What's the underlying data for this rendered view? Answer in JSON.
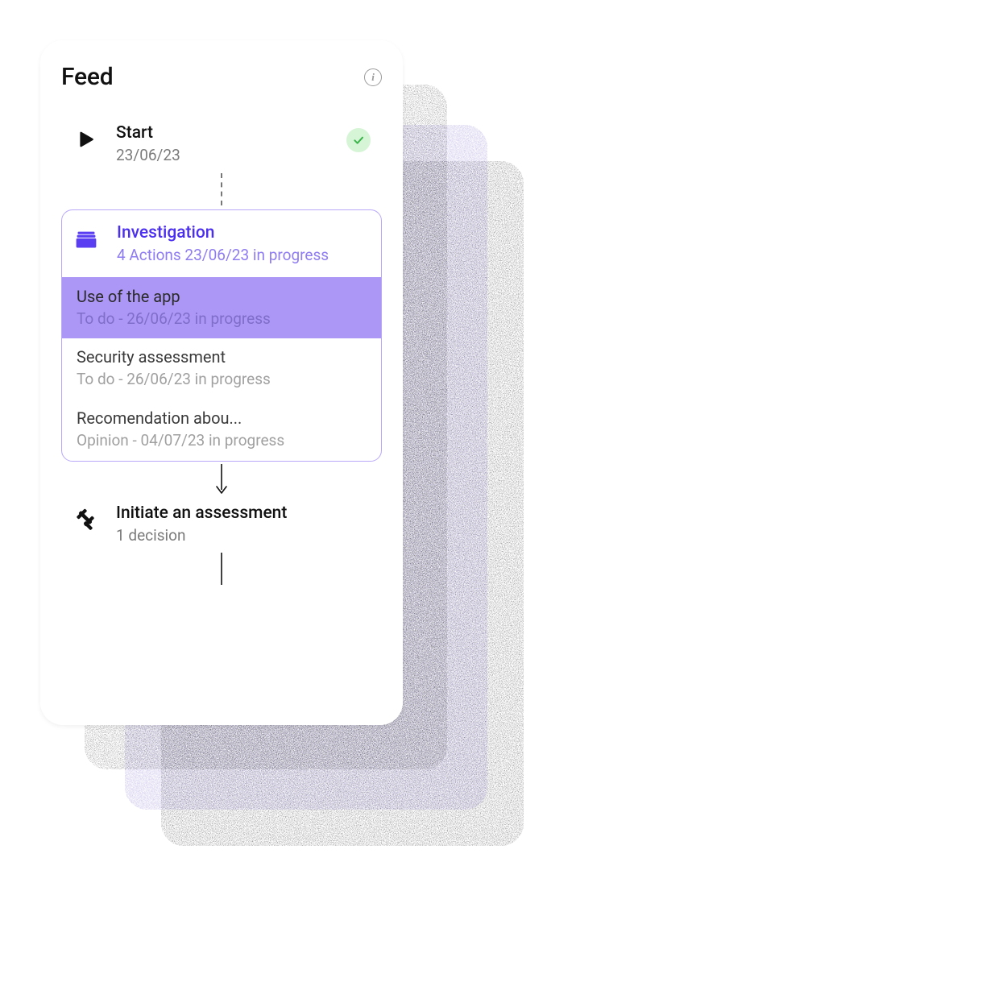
{
  "header": {
    "title": "Feed"
  },
  "steps": {
    "start": {
      "title": "Start",
      "date": "23/06/23",
      "status": "done"
    },
    "investigation": {
      "title": "Investigation",
      "meta": "4 Actions 23/06/23 in progress",
      "tasks": [
        {
          "title": "Use of the app",
          "meta": "To do - 26/06/23 in progress",
          "active": true
        },
        {
          "title": "Security assessment",
          "meta": "To do - 26/06/23 in progress",
          "active": false
        },
        {
          "title": "Recomendation abou...",
          "meta": "Opinion - 04/07/23 in progress",
          "active": false
        }
      ]
    },
    "assessment": {
      "title": "Initiate an assessment",
      "meta": "1 decision"
    }
  },
  "colors": {
    "accent": "#4b2ff0",
    "accent_light": "#ad97f6",
    "success_bg": "#d6f5d6"
  }
}
